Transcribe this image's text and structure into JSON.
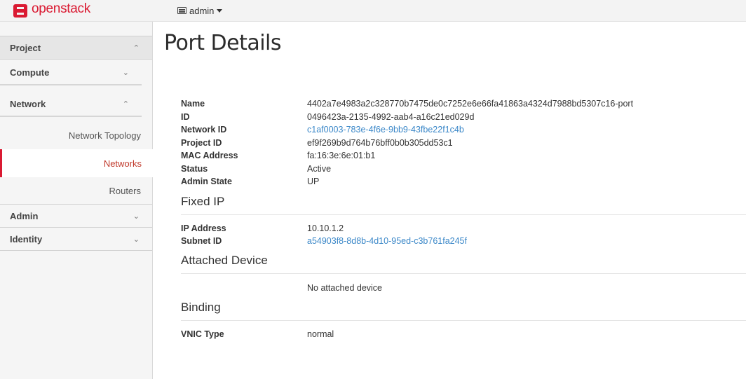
{
  "header": {
    "brand": "openstack",
    "project_label": "admin"
  },
  "sidebar": {
    "project": "Project",
    "compute": "Compute",
    "network": "Network",
    "network_items": [
      "Network Topology",
      "Networks",
      "Routers"
    ],
    "admin": "Admin",
    "identity": "Identity",
    "active_item": "Networks"
  },
  "page": {
    "title": "Port Details"
  },
  "port": {
    "rows": [
      {
        "label": "Name",
        "value": "4402a7e4983a2c328770b7475de0c7252e6e66fa41863a4324d7988bd5307c16-port"
      },
      {
        "label": "ID",
        "value": "0496423a-2135-4992-aab4-a16c21ed029d"
      },
      {
        "label": "Network ID",
        "value": "c1af0003-783e-4f6e-9bb9-43fbe22f1c4b"
      },
      {
        "label": "Project ID",
        "value": "ef9f269b9d764b76bff0b0b305dd53c1"
      },
      {
        "label": "MAC Address",
        "value": "fa:16:3e:6e:01:b1"
      },
      {
        "label": "Status",
        "value": "Active"
      },
      {
        "label": "Admin State",
        "value": "UP"
      }
    ]
  },
  "fixed_ip": {
    "title": "Fixed IP",
    "rows": [
      {
        "label": "IP Address",
        "value": "10.10.1.2"
      },
      {
        "label": "Subnet ID",
        "value": "a54903f8-8d8b-4d10-95ed-c3b761fa245f"
      }
    ]
  },
  "attached_device": {
    "title": "Attached Device",
    "empty_text": "No attached device"
  },
  "binding": {
    "title": "Binding",
    "rows": [
      {
        "label": "VNIC Type",
        "value": "normal"
      }
    ]
  },
  "colors": {
    "brand": "#da1a32",
    "link": "#3a87c8",
    "active_nav": "#c0392b"
  },
  "icons": {
    "brand": "openstack-logo-icon",
    "project_picker": "server-icon",
    "dropdown": "caret-down-icon",
    "expand": "chevron-down-icon",
    "collapse": "chevron-up-icon"
  }
}
